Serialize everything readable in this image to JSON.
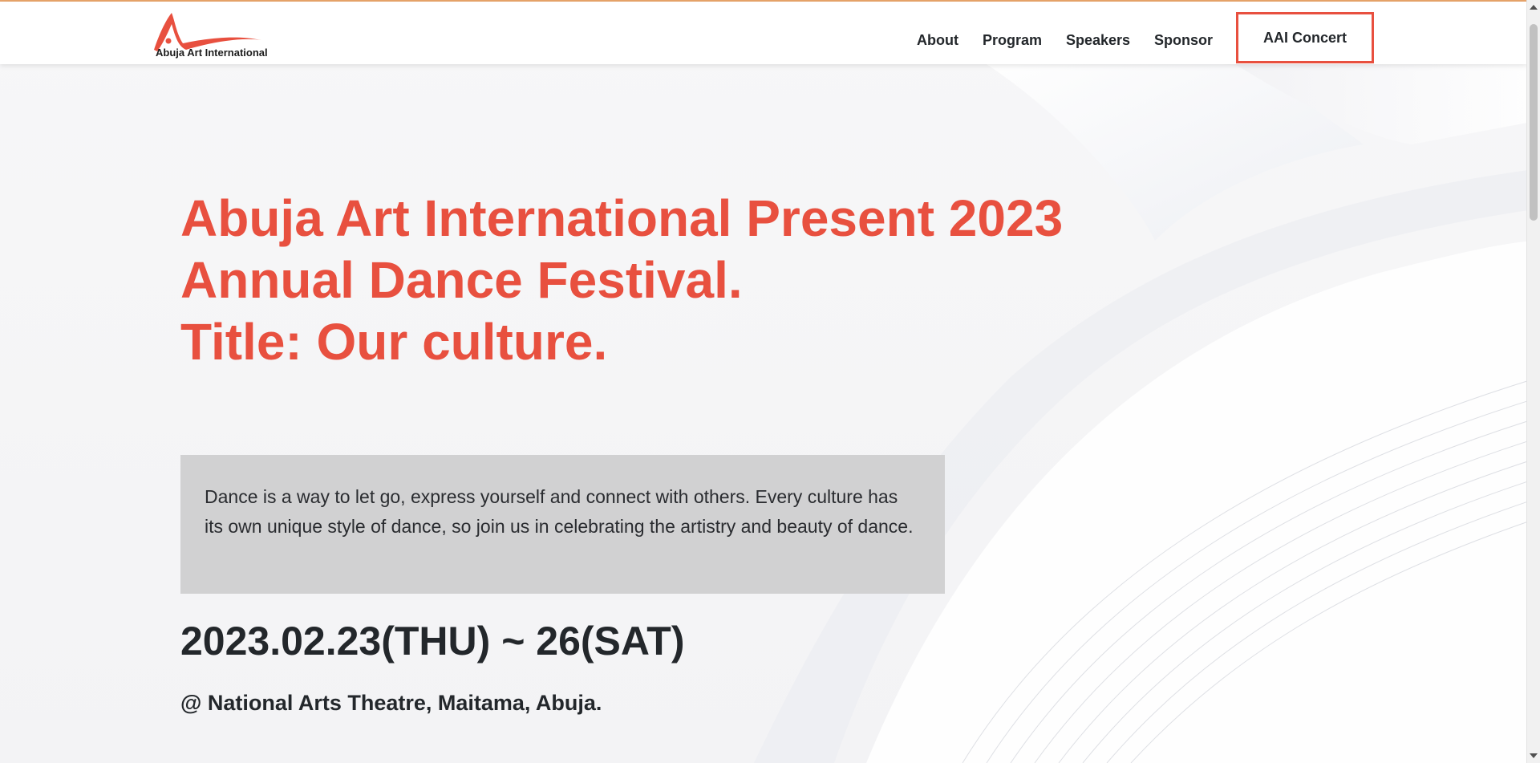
{
  "brand": {
    "name": "Abuja Art International",
    "accent_color": "#e8503f"
  },
  "nav": {
    "items": [
      "About",
      "Program",
      "Speakers",
      "Sponsor"
    ],
    "cta_label": "AAI Concert"
  },
  "hero": {
    "title_lines": [
      "Abuja Art International Present 2023",
      "Annual Dance Festival.",
      "Title: Our culture."
    ],
    "description": "Dance is a way to let go, express yourself and connect with others. Every culture has its own unique style of dance, so join us in celebrating the artistry and beauty of dance.",
    "date": "2023.02.23(THU) ~ 26(SAT)",
    "venue": "@ National Arts Theatre, Maitama, Abuja."
  },
  "icons": {
    "logo": "dancer-swoosh-logo",
    "scroll_up": "scroll-up-arrow-icon",
    "scroll_down": "scroll-down-arrow-icon"
  }
}
